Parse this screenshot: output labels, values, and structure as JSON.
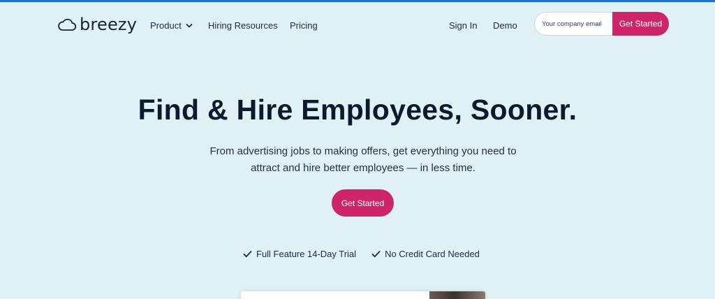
{
  "nav": {
    "logo_text": "breezy",
    "links": [
      {
        "label": "Product"
      },
      {
        "label": "Hiring Resources"
      },
      {
        "label": "Pricing"
      },
      {
        "label": "Sign In"
      },
      {
        "label": "Demo"
      }
    ],
    "email_placeholder": "Your company email",
    "cta_label": "Get Started"
  },
  "hero": {
    "title": "Find & Hire Employees, Sooner.",
    "subtitle": "From advertising jobs to making offers, get everything you need to attract and hire better employees — in less time.",
    "cta_label": "Get Started",
    "benefits": [
      "Full Feature 14-Day Trial",
      "No Credit Card Needed"
    ]
  },
  "colors": {
    "background": "#dff1f5",
    "accent": "#d0246a",
    "top_bar": "#1e6fd9"
  },
  "icons": [
    "cloud-logo-icon",
    "chevron-down-icon",
    "checkmark-icon"
  ]
}
